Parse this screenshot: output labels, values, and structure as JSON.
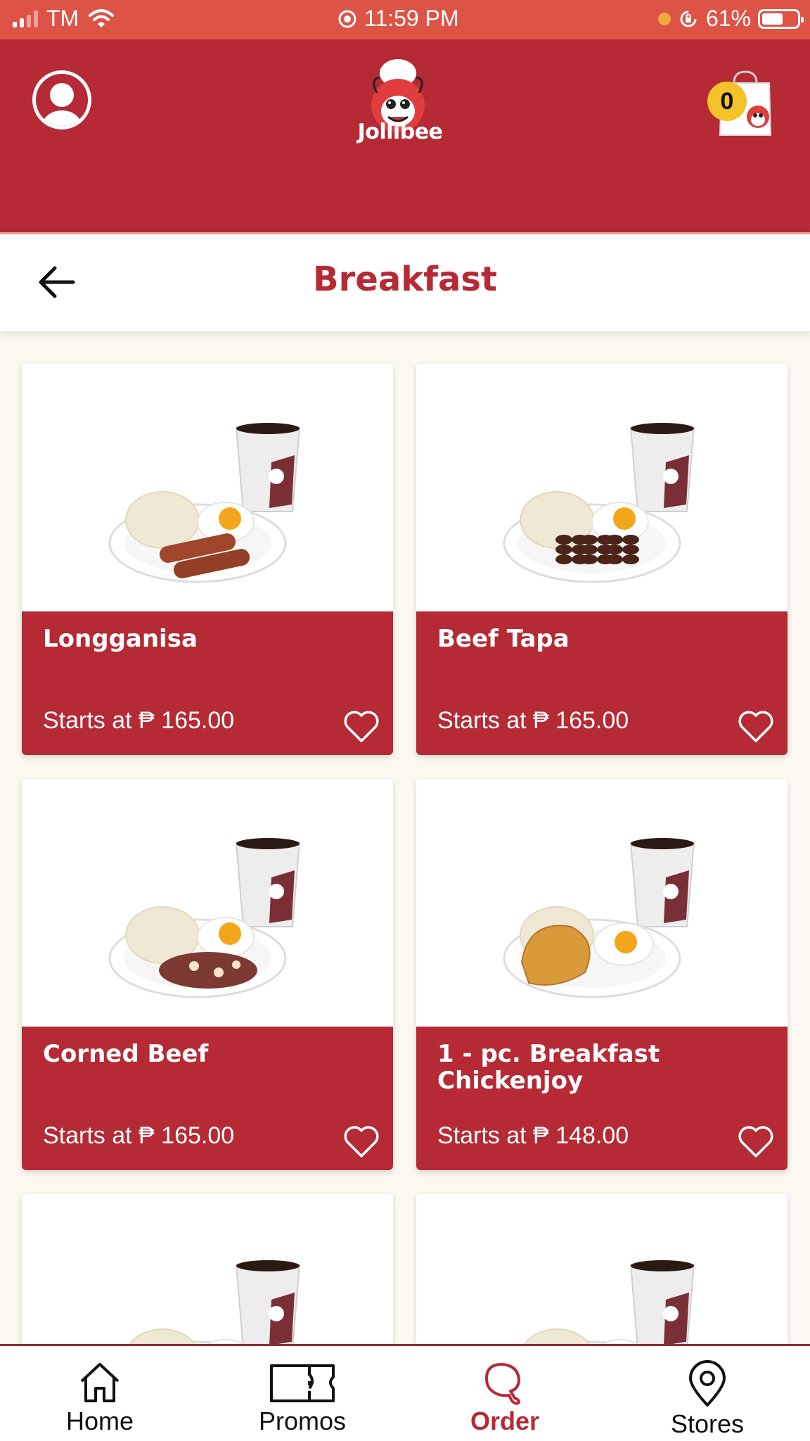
{
  "status_bar": {
    "carrier": "TM",
    "time": "11:59 PM",
    "battery": "61%",
    "battery_level": 0.61
  },
  "header": {
    "brand": "Jollibee",
    "cart_count": "0"
  },
  "page": {
    "title": "Breakfast"
  },
  "products": [
    {
      "name": "Longganisa",
      "price": "Starts at ₱ 165.00",
      "meal": "longganisa"
    },
    {
      "name": "Beef Tapa",
      "price": "Starts at ₱ 165.00",
      "meal": "tapa"
    },
    {
      "name": "Corned Beef",
      "price": "Starts at ₱ 165.00",
      "meal": "corned-beef"
    },
    {
      "name": "1 - pc. Breakfast Chickenjoy",
      "price": "Starts at ₱ 148.00",
      "meal": "chicken"
    }
  ],
  "nav": {
    "items": [
      {
        "label": "Home",
        "icon": "home-icon"
      },
      {
        "label": "Promos",
        "icon": "ticket-icon"
      },
      {
        "label": "Order",
        "icon": "drumstick-icon",
        "active": true
      },
      {
        "label": "Stores",
        "icon": "location-pin-icon"
      }
    ]
  },
  "colors": {
    "brand_red": "#b52a35",
    "status_bar": "#dd5446",
    "badge_yellow": "#f6c22a",
    "background": "#fbf8ef"
  }
}
